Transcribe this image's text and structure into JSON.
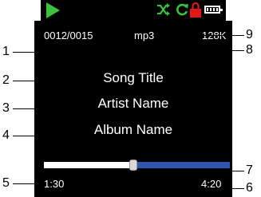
{
  "colors": {
    "screen": "#000000",
    "text": "#ffffff",
    "play": "#3cc13c",
    "lock": "#e01818",
    "progress_played": "#ffffff",
    "progress_remaining": "#2f55b0"
  },
  "status_bar": {
    "icons": [
      "play-icon",
      "shuffle-icon",
      "repeat-icon",
      "lock-icon",
      "battery-icon"
    ]
  },
  "info_row": {
    "track_counter": "0012/0015",
    "format": "mp3",
    "bitrate": "128K"
  },
  "song_title": "Song Title",
  "artist_name": "Artist Name",
  "album_name": "Album Name",
  "progress": {
    "elapsed": "1:30",
    "total": "4:20",
    "fraction": 0.48
  },
  "callouts": {
    "c1": "1",
    "c2": "2",
    "c3": "3",
    "c4": "4",
    "c5": "5",
    "c6": "6",
    "c7": "7",
    "c8": "8",
    "c9": "9"
  }
}
